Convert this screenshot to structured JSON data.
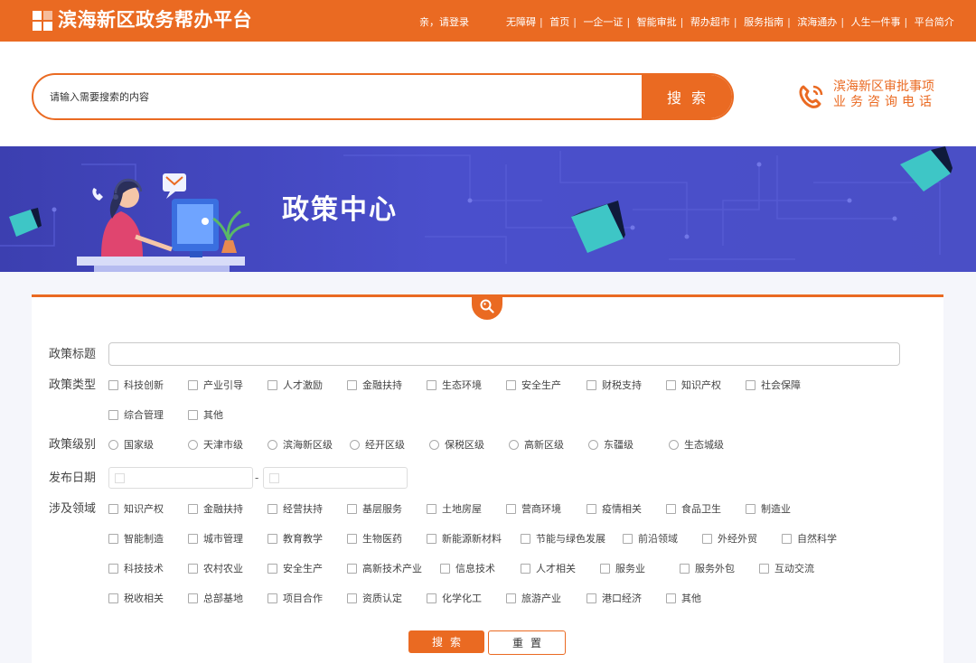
{
  "header": {
    "site_title": "滨海新区政务帮办平台",
    "login_text": "亲，请登录",
    "nav": [
      "无障碍",
      "首页",
      "一企一证",
      "智能审批",
      "帮办超市",
      "服务指南",
      "滨海通办",
      "人生一件事",
      "平台简介"
    ]
  },
  "search": {
    "placeholder": "请输入需要搜索的内容",
    "button": "搜 索"
  },
  "hotline": {
    "line1": "滨海新区审批事项",
    "line2": "业务咨询电话"
  },
  "banner": {
    "title": "政策中心"
  },
  "filters": {
    "policy_title_label": "政策标题",
    "policy_title_value": "",
    "policy_type_label": "政策类型",
    "policy_types": [
      "科技创新",
      "产业引导",
      "人才激励",
      "金融扶持",
      "生态环境",
      "安全生产",
      "财税支持",
      "知识产权",
      "社会保障",
      "综合管理",
      "其他"
    ],
    "policy_level_label": "政策级别",
    "policy_levels": [
      "国家级",
      "天津市级",
      "滨海新区级",
      "经开区级",
      "保税区级",
      "高新区级",
      "东疆级",
      "生态城级"
    ],
    "date_label": "发布日期",
    "date_separator": "-",
    "domain_label": "涉及领域",
    "domains": [
      "知识产权",
      "金融扶持",
      "经营扶持",
      "基层服务",
      "土地房屋",
      "营商环境",
      "疫情相关",
      "食品卫生",
      "制造业",
      "智能制造",
      "城市管理",
      "教育教学",
      "生物医药",
      "新能源新材料",
      "节能与绿色发展",
      "前沿领域",
      "外经外贸",
      "自然科学",
      "科技技术",
      "农村农业",
      "安全生产",
      "高新技术产业",
      "信息技术",
      "人才相关",
      "服务业",
      "服务外包",
      "互动交流",
      "税收相关",
      "总部基地",
      "项目合作",
      "资质认定",
      "化学化工",
      "旅游产业",
      "港口经济",
      "其他"
    ]
  },
  "actions": {
    "search": "搜索",
    "reset": "重置"
  },
  "colors": {
    "accent": "#ea6a22",
    "banner": "#4a4fcc"
  }
}
